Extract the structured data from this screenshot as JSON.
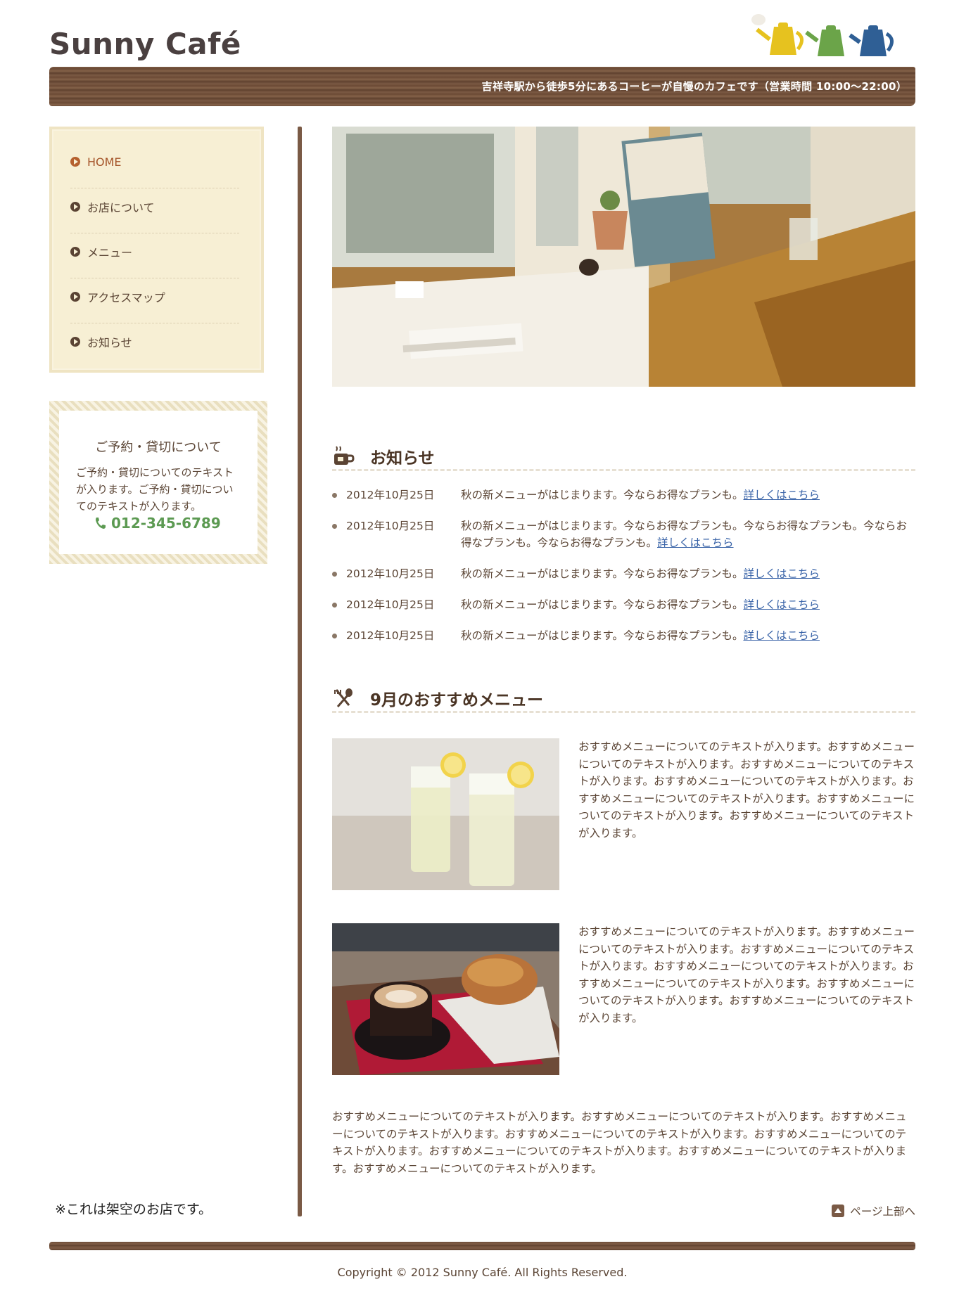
{
  "site": {
    "logo": "Sunny Café",
    "tagline": "吉祥寺駅から徒歩5分にあるコーヒーが自慢のカフェです（営業時間 10:00〜22:00）"
  },
  "nav": {
    "items": [
      {
        "label": "HOME",
        "active": true
      },
      {
        "label": "お店について",
        "active": false
      },
      {
        "label": "メニュー",
        "active": false
      },
      {
        "label": "アクセスマップ",
        "active": false
      },
      {
        "label": "お知らせ",
        "active": false
      }
    ]
  },
  "reservation": {
    "title": "ご予約・貸切について",
    "text": "ご予約・貸切についてのテキストが入ります。ご予約・貸切についてのテキストが入ります。",
    "phone": "012-345-6789"
  },
  "notice": "※これは架空のお店です。",
  "news": {
    "title": "お知らせ",
    "items": [
      {
        "date": "2012年10月25日",
        "text": "秋の新メニューがはじまります。今ならお得なプランも。",
        "link": "詳しくはこちら"
      },
      {
        "date": "2012年10月25日",
        "text": "秋の新メニューがはじまります。今ならお得なプランも。今ならお得なプランも。今ならお得なプランも。今ならお得なプランも。",
        "link": "詳しくはこちら"
      },
      {
        "date": "2012年10月25日",
        "text": "秋の新メニューがはじまります。今ならお得なプランも。",
        "link": "詳しくはこちら"
      },
      {
        "date": "2012年10月25日",
        "text": "秋の新メニューがはじまります。今ならお得なプランも。",
        "link": "詳しくはこちら"
      },
      {
        "date": "2012年10月25日",
        "text": "秋の新メニューがはじまります。今ならお得なプランも。",
        "link": "詳しくはこちら"
      }
    ]
  },
  "recommend": {
    "title": "9月のおすすめメニュー",
    "items": [
      {
        "text": "おすすめメニューについてのテキストが入ります。おすすめメニューについてのテキストが入ります。おすすめメニューについてのテキストが入ります。おすすめメニューについてのテキストが入ります。おすすめメニューについてのテキストが入ります。おすすめメニューについてのテキストが入ります。おすすめメニューについてのテキストが入ります。"
      },
      {
        "text": "おすすめメニューについてのテキストが入ります。おすすめメニューについてのテキストが入ります。おすすめメニューについてのテキストが入ります。おすすめメニューについてのテキストが入ります。おすすめメニューについてのテキストが入ります。おすすめメニューについてのテキストが入ります。おすすめメニューについてのテキストが入ります。"
      }
    ],
    "paragraph": "おすすめメニューについてのテキストが入ります。おすすめメニューについてのテキストが入ります。おすすめメニューについてのテキストが入ります。おすすめメニューについてのテキストが入ります。おすすめメニューについてのテキストが入ります。おすすめメニューについてのテキストが入ります。おすすめメニューについてのテキストが入ります。おすすめメニューについてのテキストが入ります。"
  },
  "pagetop": "ページ上部へ",
  "copyright": "Copyright © 2012 Sunny Café. All Rights Reserved.",
  "colors": {
    "wood": "#7a5a45",
    "accent": "#a5552a",
    "phone": "#5c9a52",
    "link": "#3a64a8"
  }
}
